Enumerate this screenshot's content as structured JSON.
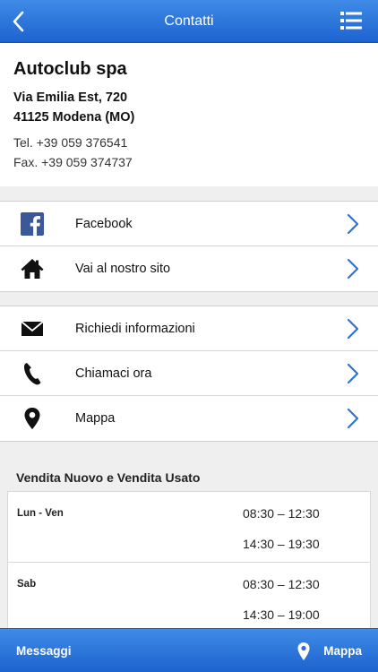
{
  "navbar": {
    "title": "Contatti",
    "back_icon": "chevron-left-icon",
    "menu_icon": "list-menu-icon"
  },
  "contact": {
    "company": "Autoclub spa",
    "address_line1": "Via Emilia Est, 720",
    "address_line2": "41125 Modena (MO)",
    "tel": "Tel. +39 059 376541",
    "fax": "Fax. +39 059 374737"
  },
  "links": [
    {
      "label": "Facebook",
      "icon": "facebook-icon"
    },
    {
      "label": "Vai al nostro sito",
      "icon": "home-icon"
    }
  ],
  "actions": [
    {
      "label": "Richiedi informazioni",
      "icon": "mail-icon"
    },
    {
      "label": "Chiamaci ora",
      "icon": "phone-icon"
    },
    {
      "label": "Mappa",
      "icon": "map-pin-icon"
    }
  ],
  "hours": {
    "title": "Vendita Nuovo e Vendita Usato",
    "rows": [
      {
        "day": "Lun - Ven",
        "slot1": "08:30 – 12:30",
        "slot2": "14:30 – 19:30"
      },
      {
        "day": "Sab",
        "slot1": "08:30 – 12:30",
        "slot2": "14:30 – 19:00"
      }
    ]
  },
  "tabbar": {
    "left_label": "Messaggi",
    "right_label": "Mappa",
    "right_icon": "map-pin-icon"
  },
  "colors": {
    "bar_blue": "#2f78de",
    "chevron_blue": "#2f74d0",
    "facebook_blue": "#3b5998"
  }
}
